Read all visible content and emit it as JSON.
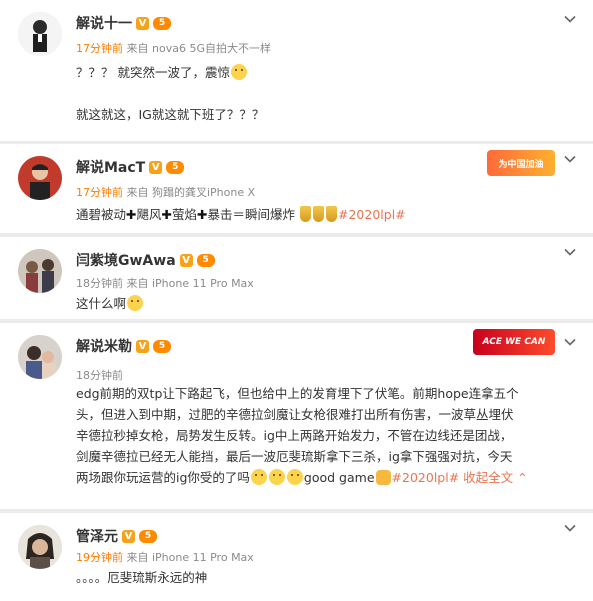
{
  "comments": [
    {
      "name": "解说十一",
      "level": "5",
      "time": "17分钟前",
      "source": "来自 nova6 5G自拍大不一样",
      "lines": [
        "？？？ 就突然一波了，震惊",
        "就这就这，IG就这就下班了？？？"
      ]
    },
    {
      "name": "解说MacT",
      "level": "5",
      "time": "17分钟前",
      "source": "来自 狗蹋的龚叉iPhone X",
      "text_parts": [
        "通碧被动",
        "飓风",
        "萤焰",
        "暴击＝瞬间爆炸"
      ],
      "hashtag": "#2020lpl#",
      "deco_text": "为中国加油"
    },
    {
      "name": "闫紫境GwAwa",
      "level": "5",
      "time": "18分钟前",
      "source": "来自 iPhone 11 Pro Max",
      "text": "这什么啊"
    },
    {
      "name": "解说米勒",
      "level": "5",
      "time": "18分钟前",
      "source": "",
      "lines": [
        "edg前期的双tp让下路起飞，但也给中上的发育埋下了伏笔。前期hope连拿五个",
        "头，但进入到中期，过肥的辛德拉剑魔让女枪很难打出所有伤害，一波草丛埋伏",
        "辛德拉秒掉女枪，局势发生反转。ig中上两路开始发力，不管在边线还是团战，",
        "剑魔辛德拉已经无人能挡，最后一波厄斐琉斯拿下三杀，ig拿下强强对抗，今天",
        "两场跟你玩运营的ig你受的了吗"
      ],
      "tail": "good game",
      "hashtag": "#2020lpl#",
      "expand": "收起全文",
      "deco_text": "ACE WE CAN"
    },
    {
      "name": "管泽元",
      "level": "5",
      "time": "19分钟前",
      "source": "来自 iPhone 11 Pro Max",
      "text": "。。。。厄斐琉斯永远的神"
    }
  ],
  "badges": {
    "verified": "V"
  },
  "colors": {
    "time": "#ff7a00",
    "hashtag": "#eb7350",
    "badge": "#f7a21b"
  }
}
